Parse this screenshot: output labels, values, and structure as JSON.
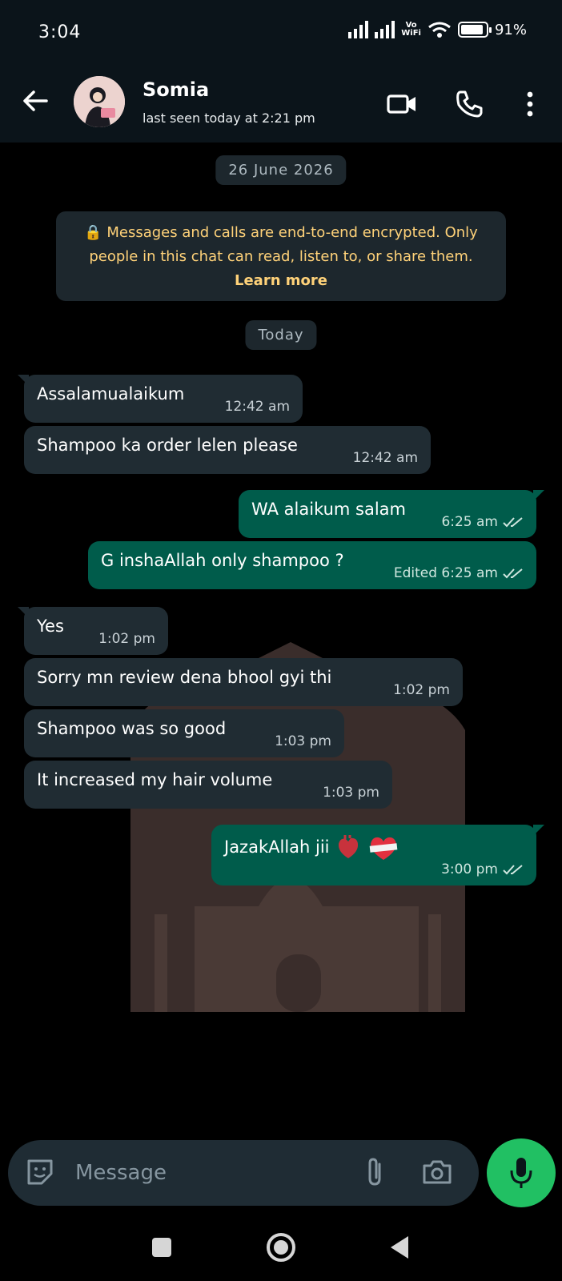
{
  "status": {
    "time": "3:04",
    "volte": "Vo\nWiFi",
    "battery": "91%"
  },
  "header": {
    "name": "Somia",
    "last_seen": "last seen today at 2:21 pm"
  },
  "chat": {
    "date_pill": "26 June 2026",
    "encryption_text": "🔒 Messages and calls are end-to-end encrypted. Only people in this chat can read, listen to, or share them.",
    "learn_more": "Learn more",
    "today_pill": "Today",
    "messages": [
      {
        "dir": "in",
        "text": "Assalamualaikum",
        "time": "12:42 am"
      },
      {
        "dir": "in",
        "text": "Shampoo ka order lelen please",
        "time": "12:42 am"
      },
      {
        "dir": "out",
        "text": "WA alaikum salam",
        "time": "6:25 am"
      },
      {
        "dir": "out",
        "text": "G inshaAllah only shampoo ?",
        "time": "Edited 6:25 am"
      },
      {
        "dir": "in",
        "text": "Yes",
        "time": "1:02 pm"
      },
      {
        "dir": "in",
        "text": "Sorry mn review dena bhool gyi thi",
        "time": "1:02 pm"
      },
      {
        "dir": "in",
        "text": "Shampoo was so good",
        "time": "1:03 pm"
      },
      {
        "dir": "in",
        "text": "It increased my hair volume",
        "time": "1:03 pm"
      },
      {
        "dir": "out",
        "text": "JazakAllah jii",
        "time": "3:00 pm"
      }
    ]
  },
  "composer": {
    "placeholder": "Message"
  },
  "colors": {
    "incoming": "#202c33",
    "outgoing": "#005c4b",
    "mic": "#21c063",
    "encryption": "#ffd279"
  }
}
